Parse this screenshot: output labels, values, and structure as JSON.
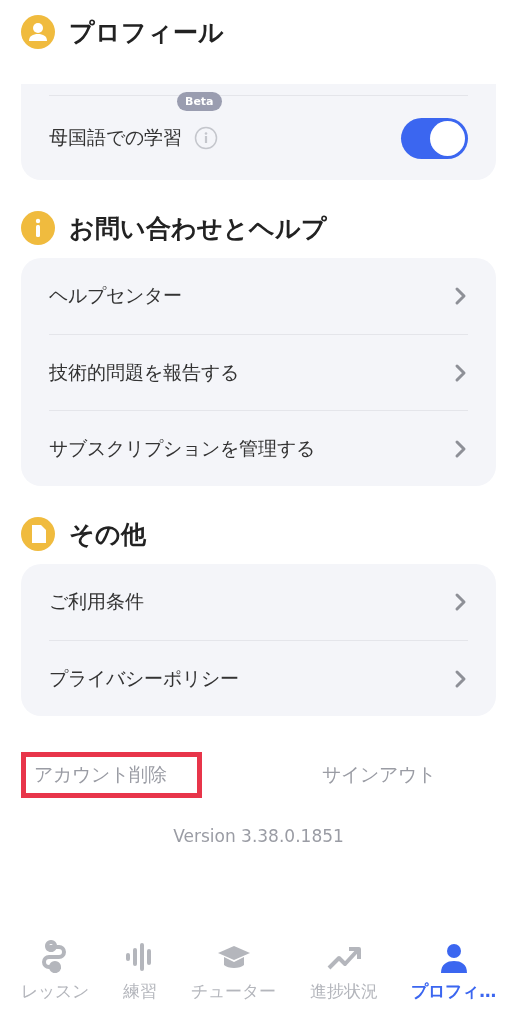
{
  "sections": [
    {
      "title": "プロフィール",
      "kind": "person",
      "rows": [
        {
          "kind": "toggle",
          "label": "母国語での学習",
          "badge": "Beta",
          "on": true
        }
      ]
    },
    {
      "title": "お問い合わせとヘルプ",
      "kind": "info",
      "rows": [
        {
          "kind": "link",
          "label": "ヘルプセンター"
        },
        {
          "kind": "link",
          "label": "技術的問題を報告する"
        },
        {
          "kind": "link",
          "label": "サブスクリプションを管理する"
        }
      ]
    },
    {
      "title": "その他",
      "kind": "doc",
      "rows": [
        {
          "kind": "link",
          "label": "ご利用条件"
        },
        {
          "kind": "link",
          "label": "プライバシーポリシー"
        }
      ]
    }
  ],
  "account_links": [
    {
      "label": "アカウント削除",
      "highlighted": true
    },
    {
      "label": "サインアウト",
      "highlighted": false
    }
  ],
  "version": "Version 3.38.0.1851",
  "tabs": [
    {
      "label": "レッスン",
      "kind": "path",
      "selected": false
    },
    {
      "label": "練習",
      "kind": "wave",
      "selected": false
    },
    {
      "label": "チューター",
      "kind": "cap",
      "selected": false
    },
    {
      "label": "進捗状況",
      "kind": "trend",
      "selected": false
    },
    {
      "label": "プロフィ…",
      "kind": "person",
      "selected": true
    }
  ]
}
